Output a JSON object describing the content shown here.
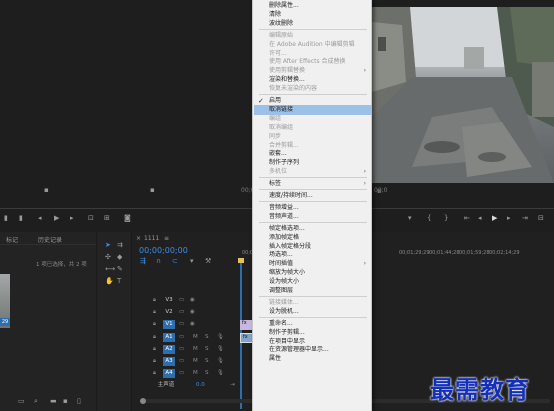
{
  "context_menu": {
    "items": [
      {
        "label": "删除属性...",
        "disabled": false
      },
      {
        "label": "清除",
        "disabled": false
      },
      {
        "label": "波纹删除",
        "disabled": false
      },
      {
        "sep": true
      },
      {
        "label": "编辑原始",
        "disabled": true
      },
      {
        "label": "在 Adobe Audition 中编辑剪辑",
        "disabled": true
      },
      {
        "label": "许可...",
        "disabled": true
      },
      {
        "label": "使用 After Effects 合成替换",
        "disabled": true
      },
      {
        "label": "使用剪辑替换",
        "disabled": true,
        "submenu": true
      },
      {
        "label": "渲染和替换...",
        "disabled": false
      },
      {
        "label": "恢复未渲染的内容",
        "disabled": true
      },
      {
        "sep": true
      },
      {
        "label": "启用",
        "disabled": false,
        "checked": true
      },
      {
        "label": "取消链接",
        "disabled": false,
        "highlighted": true
      },
      {
        "label": "编组",
        "disabled": true
      },
      {
        "label": "取消编组",
        "disabled": true
      },
      {
        "label": "同步",
        "disabled": true
      },
      {
        "label": "合并剪辑...",
        "disabled": true
      },
      {
        "label": "嵌套...",
        "disabled": false
      },
      {
        "label": "制作子序列",
        "disabled": false
      },
      {
        "label": "多机位",
        "disabled": true,
        "submenu": true
      },
      {
        "sep": true
      },
      {
        "label": "标签",
        "disabled": false,
        "submenu": true
      },
      {
        "sep": true
      },
      {
        "label": "速度/持续时间...",
        "disabled": false
      },
      {
        "sep": true
      },
      {
        "label": "音频增益...",
        "disabled": false
      },
      {
        "label": "音频声道...",
        "disabled": false
      },
      {
        "sep": true
      },
      {
        "label": "帧定格选项...",
        "disabled": false
      },
      {
        "label": "添加帧定格",
        "disabled": false
      },
      {
        "label": "插入帧定格分段",
        "disabled": false
      },
      {
        "label": "场选项...",
        "disabled": false
      },
      {
        "label": "时间插值",
        "disabled": false,
        "submenu": true
      },
      {
        "label": "缩放为帧大小",
        "disabled": false
      },
      {
        "label": "设为帧大小",
        "disabled": false
      },
      {
        "label": "调整图层",
        "disabled": false
      },
      {
        "sep": true
      },
      {
        "label": "链接媒体...",
        "disabled": true
      },
      {
        "label": "设为脱机...",
        "disabled": false
      },
      {
        "sep": true
      },
      {
        "label": "重命名...",
        "disabled": false
      },
      {
        "label": "制作子剪辑...",
        "disabled": false
      },
      {
        "label": "在项目中显示",
        "disabled": false
      },
      {
        "label": "在资源管理器中显示...",
        "disabled": false
      },
      {
        "label": "属性",
        "disabled": false
      }
    ]
  },
  "project_panel": {
    "tabs": [
      "标记",
      "历史记录"
    ],
    "selection_info": "1 项已选择，共 2 项",
    "thumb_badge": "29"
  },
  "timeline": {
    "sequence_name": "1111",
    "timecode": "00;00;00;00",
    "ruler": [
      "00;00",
      "00;00;14;29",
      "00;00;29;29",
      "00;00;44;28",
      "00;00;59;28",
      "00;01;14;29",
      "00;01;29;29",
      "00;01;44;28",
      "00;01;59;28",
      "00;02;14;29"
    ],
    "video_tracks": [
      "V3",
      "V2",
      "V1"
    ],
    "audio_tracks": [
      "A1",
      "A2",
      "A3",
      "A4"
    ],
    "master_label": "主声道",
    "master_value": "0.0",
    "track_buttons": {
      "mute": "M",
      "solo": "S"
    }
  },
  "monitors": {
    "source_timecode": "00;0",
    "program_timecode": "00;0"
  },
  "watermark": "最需教育",
  "colors": {
    "accent": "#2d6fae",
    "timecode": "#3a8ee6",
    "menu_highlight": "#9cc0e6",
    "watermark": "#1530b8"
  }
}
